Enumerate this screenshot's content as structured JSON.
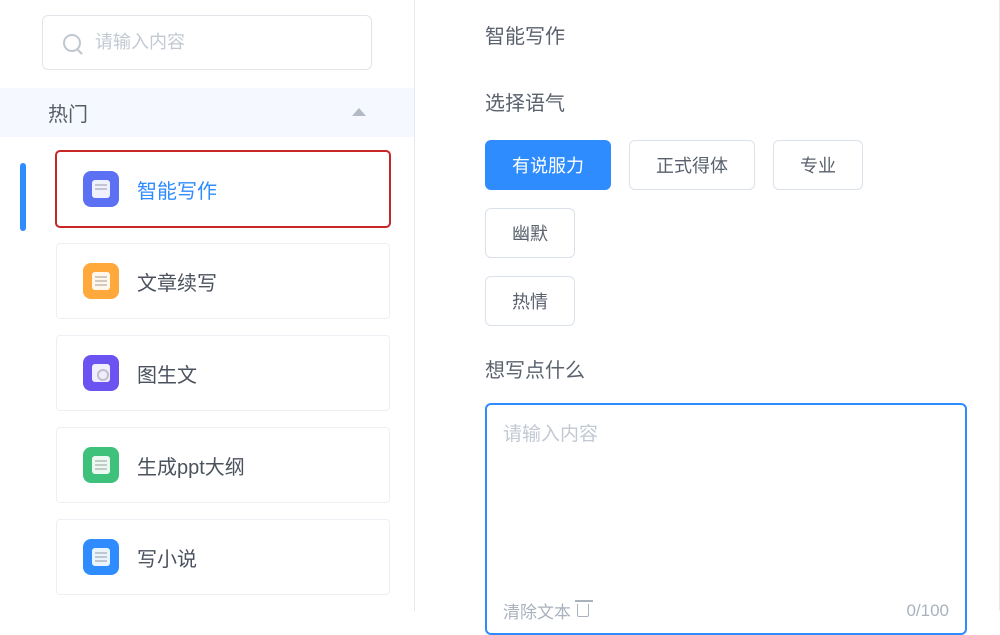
{
  "sidebar": {
    "search_placeholder": "请输入内容",
    "section_title": "热门",
    "items": [
      {
        "label": "智能写作",
        "icon": "icon-purple",
        "active": true,
        "highlighted": true
      },
      {
        "label": "文章续写",
        "icon": "icon-orange",
        "active": false,
        "highlighted": false
      },
      {
        "label": "图生文",
        "icon": "icon-purple2",
        "active": false,
        "highlighted": false
      },
      {
        "label": "生成ppt大纲",
        "icon": "icon-green",
        "active": false,
        "highlighted": false
      },
      {
        "label": "写小说",
        "icon": "icon-blue",
        "active": false,
        "highlighted": false
      }
    ]
  },
  "main": {
    "title": "智能写作",
    "tone_label": "选择语气",
    "tones": [
      {
        "label": "有说服力",
        "selected": true
      },
      {
        "label": "正式得体",
        "selected": false
      },
      {
        "label": "专业",
        "selected": false
      },
      {
        "label": "幽默",
        "selected": false
      },
      {
        "label": "热情",
        "selected": false
      }
    ],
    "content_label": "想写点什么",
    "content_placeholder": "请输入内容",
    "clear_label": "清除文本",
    "counter": "0/100"
  }
}
